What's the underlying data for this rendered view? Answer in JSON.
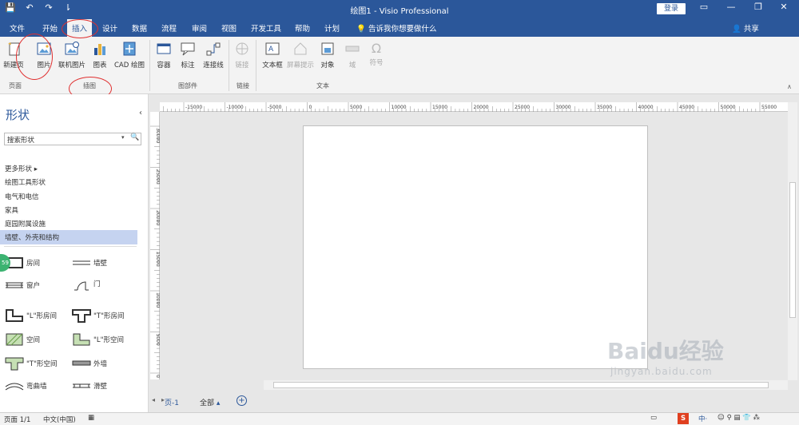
{
  "title_bar": {
    "title": "绘图1  -  Visio Professional",
    "login": "登录",
    "qat": [
      "💾",
      "↶",
      "↷",
      "⇂"
    ]
  },
  "menu": {
    "tabs": [
      "文件",
      "开始",
      "插入",
      "设计",
      "数据",
      "流程",
      "审阅",
      "视图",
      "开发工具",
      "帮助",
      "计划"
    ],
    "active_tab": "插入",
    "tell_me": "告诉我你想要做什么",
    "share": "共享"
  },
  "ribbon": {
    "groups": {
      "pages": "页面",
      "illustrations": "插图",
      "diagram_parts": "图部件",
      "links": "链接",
      "text": "文本"
    },
    "buttons": {
      "new_page": "新建页",
      "picture": "图片",
      "online_picture": "联机图片",
      "chart": "图表",
      "cad": "CAD 绘图",
      "container": "容器",
      "callout": "标注",
      "connector": "连接线",
      "link": "链接",
      "textbox": "文本框",
      "screentip": "屏幕提示",
      "object": "对象",
      "field": "域",
      "symbol": "符号"
    }
  },
  "shapes_panel": {
    "title": "形状",
    "search_placeholder": "搜索形状",
    "more_shapes": "更多形状",
    "stencils": [
      "绘图工具形状",
      "电气和电信",
      "家具",
      "庭园附属设施",
      "墙壁、外壳和结构"
    ],
    "active_stencil": "墙壁、外壳和结构",
    "shapes": [
      "房间",
      "墙壁",
      "窗户",
      "门",
      "\"L\"形房间",
      "\"T\"形房间",
      "空间",
      "\"L\"形空间",
      "\"T\"形空间",
      "外墙",
      "弯曲墙",
      "滑壁"
    ],
    "badge": "59"
  },
  "ruler": {
    "h_labels": [
      "-15000",
      "-10000",
      "-5000",
      "0",
      "5000",
      "10000",
      "15000",
      "20000",
      "25000",
      "30000",
      "35000",
      "40000",
      "45000",
      "50000",
      "55000"
    ],
    "v_labels": [
      "30000",
      "25000",
      "20000",
      "15000",
      "10000",
      "5000",
      "0"
    ]
  },
  "page_tabs": {
    "current": "页-1",
    "all": "全部"
  },
  "status": {
    "page": "页面 1/1",
    "language": "中文(中国)"
  },
  "watermark": {
    "brand": "Baidu经验",
    "url": "jingyan.baidu.com"
  },
  "colors": {
    "accent": "#2b579a",
    "annotation": "#e03030"
  }
}
